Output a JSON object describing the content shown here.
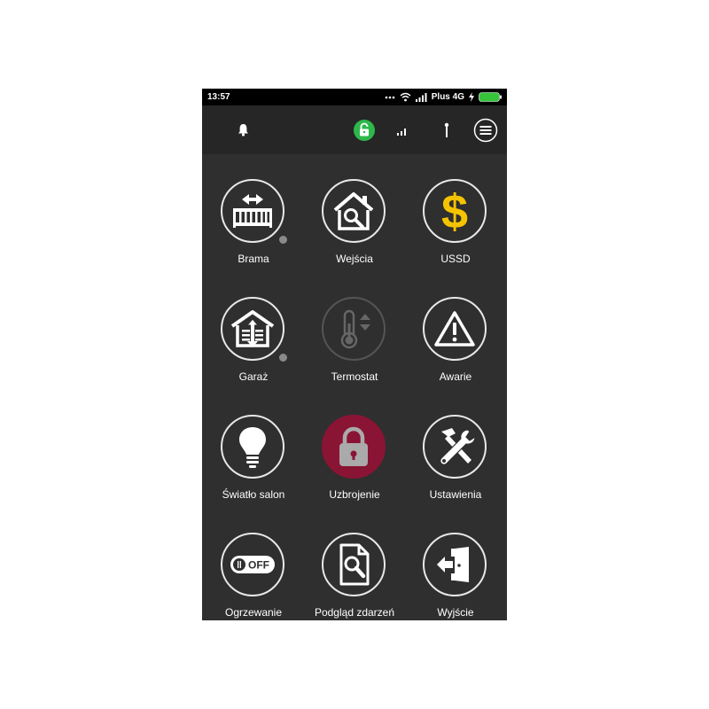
{
  "status_bar": {
    "time": "13:57",
    "carrier": "Plus 4G",
    "icons": [
      "dots-icon",
      "wifi-icon",
      "signal-icon",
      "charging-icon",
      "battery-icon"
    ],
    "battery_color": "#35c43a"
  },
  "app_bar": {
    "icons": [
      "bell-icon",
      "lock-status-icon",
      "signal-strength-icon",
      "antenna-icon",
      "menu-icon"
    ],
    "lock_badge_color": "#2eb84b"
  },
  "tiles": [
    {
      "label": "Brama",
      "icon": "gate-icon",
      "has_indicator": true
    },
    {
      "label": "Wejścia",
      "icon": "house-search-icon"
    },
    {
      "label": "USSD",
      "icon": "dollar-icon",
      "accent": "#f5c400"
    },
    {
      "label": "Garaż",
      "icon": "garage-icon",
      "has_indicator": true
    },
    {
      "label": "Termostat",
      "icon": "thermostat-icon",
      "state": "disabled"
    },
    {
      "label": "Awarie",
      "icon": "warning-icon"
    },
    {
      "label": "Światło salon",
      "icon": "lightbulb-icon"
    },
    {
      "label": "Uzbrojenie",
      "icon": "padlock-icon",
      "state": "armed",
      "accent": "#8a1434"
    },
    {
      "label": "Ustawienia",
      "icon": "tools-icon"
    },
    {
      "label": "Ogrzewanie",
      "icon": "toggle-off-icon",
      "toggle_text": "OFF"
    },
    {
      "label": "Podgląd zdarzeń",
      "icon": "document-search-icon"
    },
    {
      "label": "Wyjście",
      "icon": "exit-door-icon"
    }
  ]
}
